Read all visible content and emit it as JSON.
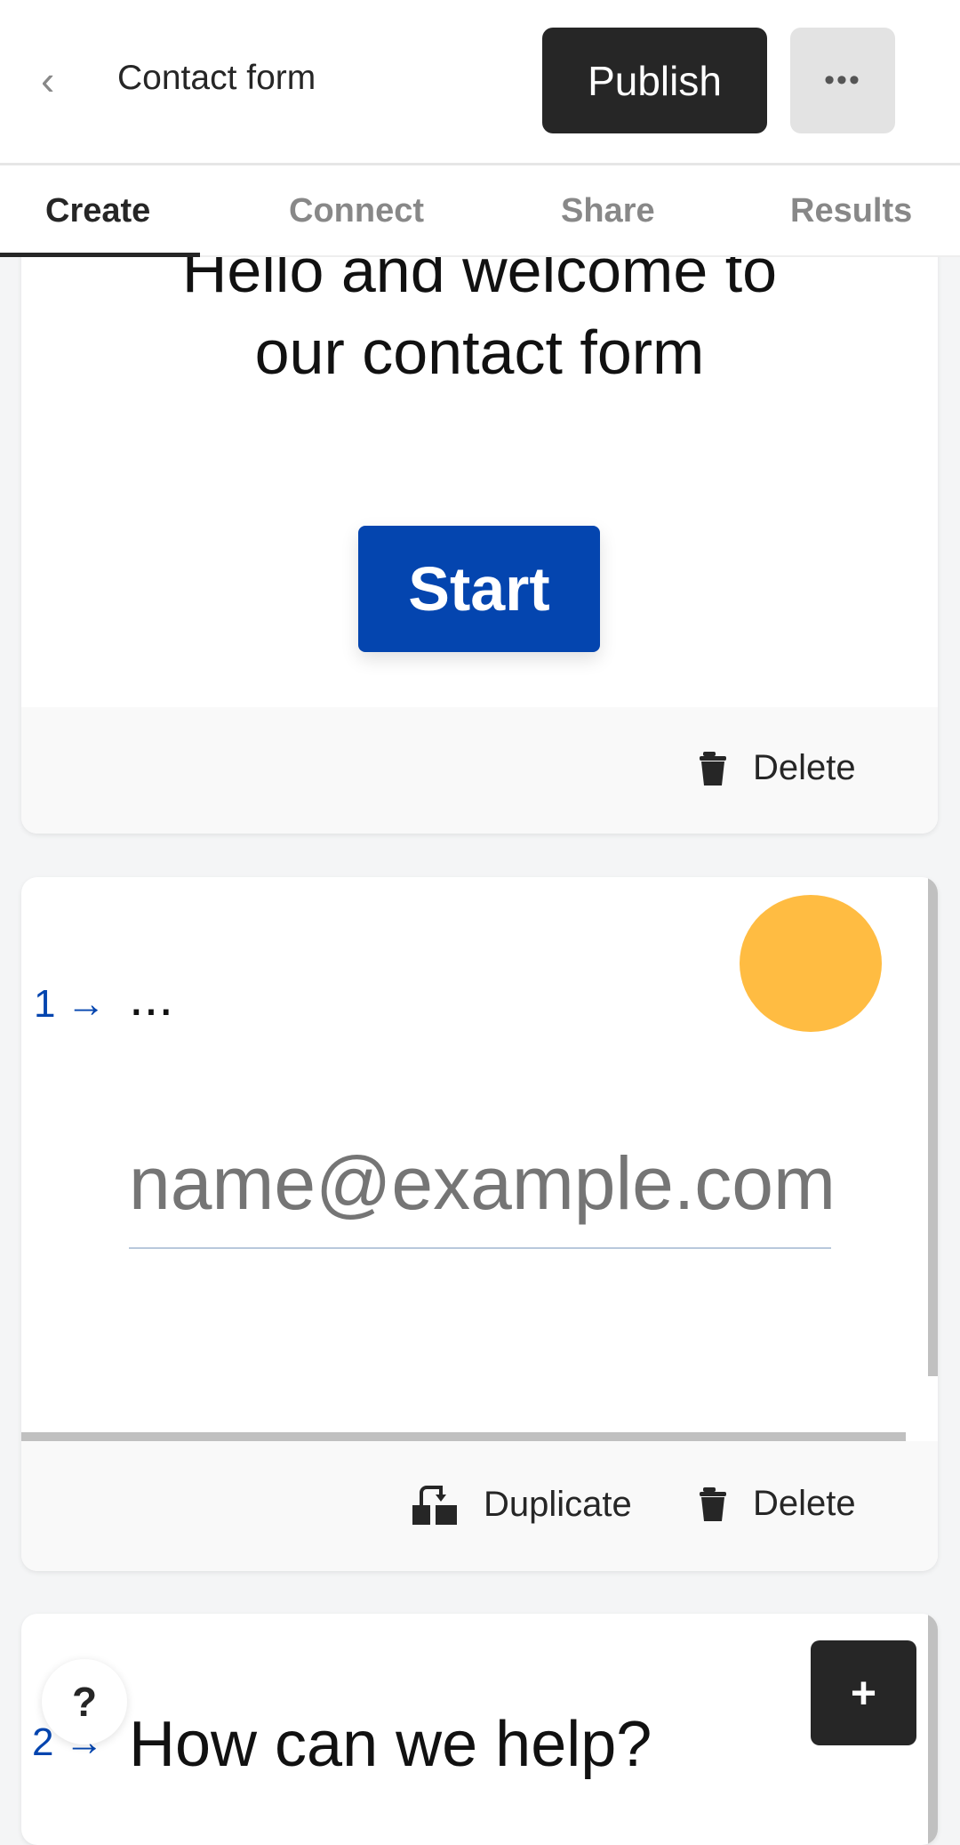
{
  "header": {
    "back_icon": "chevron-left-icon",
    "title": "Contact form",
    "publish_label": "Publish",
    "more_label": "•••"
  },
  "tabs": [
    {
      "label": "Create",
      "active": true
    },
    {
      "label": "Connect"
    },
    {
      "label": "Share"
    },
    {
      "label": "Results"
    }
  ],
  "welcome_card": {
    "title_line1": "Hello and welcome to",
    "title_line2": "our contact form",
    "start_label": "Start",
    "delete_label": "Delete"
  },
  "question1": {
    "number": "1",
    "arrow": "→",
    "text": "...",
    "placeholder": "name@example.com",
    "duplicate_label": "Duplicate",
    "delete_label": "Delete",
    "avatar_color": "#ffbc42"
  },
  "question2": {
    "number": "2",
    "arrow": "→",
    "text": "How can we help?",
    "add_label": "+"
  },
  "help": {
    "label": "?"
  },
  "colors": {
    "accent": "#0445af",
    "dark": "#262626",
    "placeholder": "#b3c7e6"
  }
}
